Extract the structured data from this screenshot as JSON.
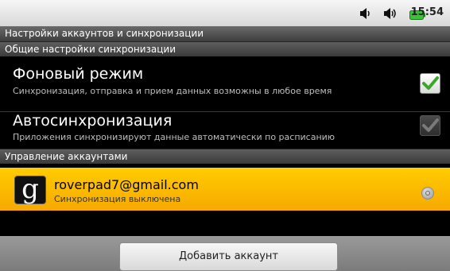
{
  "status_bar": {
    "time": "15:54",
    "icons": [
      "volume-icon",
      "ringer-icon",
      "battery-icon"
    ],
    "battery_color": "#3cc13c"
  },
  "screen": {
    "title": "Настройки аккаунтов и синхронизации"
  },
  "sections": {
    "general": {
      "header": "Общие настройки синхронизации",
      "background_data": {
        "title": "Фоновый режим",
        "summary": "Синхронизация, отправка и прием данных возможны в любое время",
        "checked": true
      },
      "auto_sync": {
        "title": "Автосинхронизация",
        "summary": "Приложения синхронизируют данные автоматически по расписанию",
        "checked": true,
        "enabled": false
      }
    },
    "accounts": {
      "header": "Управление аккаунтами",
      "items": [
        {
          "email": "roverpad7@gmail.com",
          "status": "Синхронизация выключена",
          "icon": "google-g-icon"
        }
      ]
    }
  },
  "footer": {
    "add_account_label": "Добавить аккаунт"
  },
  "colors": {
    "accent_highlight": "#ffc000",
    "check_green": "#4caf2a"
  }
}
